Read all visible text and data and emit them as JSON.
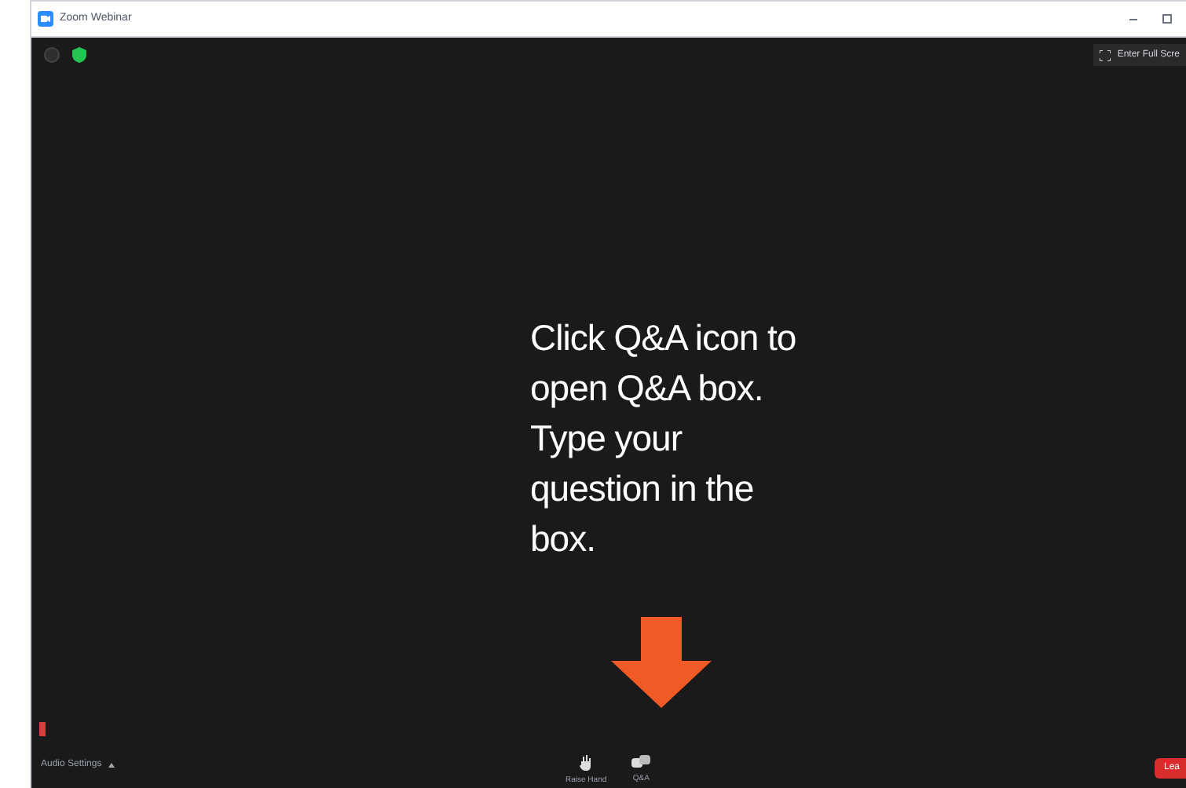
{
  "window": {
    "title": "Zoom Webinar"
  },
  "top_bar": {
    "fullscreen_button": "Enter Full Scre"
  },
  "instruction": {
    "lines": [
      "Click Q&A icon to",
      "open Q&A box.",
      "Type your",
      "question in the",
      "box."
    ]
  },
  "bottom_bar": {
    "audio_settings": "Audio Settings",
    "tools": [
      {
        "kind": "hand",
        "label": "Raise Hand"
      },
      {
        "kind": "qa",
        "label": "Q&A"
      }
    ],
    "leave_button": "Lea"
  }
}
